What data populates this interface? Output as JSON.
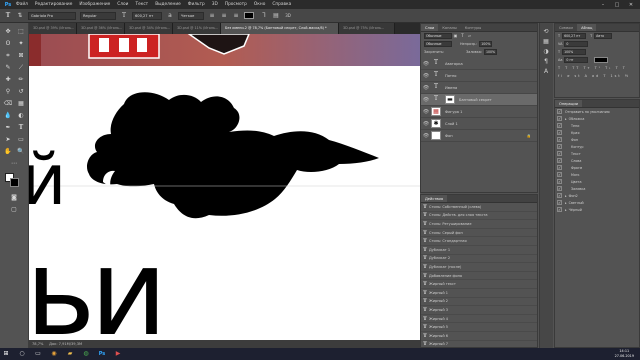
{
  "menu": [
    "Файл",
    "Редактирование",
    "Изображение",
    "Слои",
    "Текст",
    "Выделение",
    "Фильтр",
    "3D",
    "Просмотр",
    "Окно",
    "Справка"
  ],
  "options": {
    "font_family": "Gabriola Pro",
    "font_style": "Regular",
    "font_size": "600,27 пт",
    "aa": "Четкое",
    "color": "#000000"
  },
  "tabs": [
    {
      "label": "3D.psd @ 39% (Иголь...",
      "active": false
    },
    {
      "label": "3D.psd @ 36% (Иголь...",
      "active": false
    },
    {
      "label": "3D.psd @ 34% (Иголь...",
      "active": false
    },
    {
      "label": "3D.psd @ 11% (Иголь...",
      "active": false
    },
    {
      "label": "Без имени-2 @ 78,7% (Бантовый секрет, Слой-маска/8) *",
      "active": true
    },
    {
      "label": "3D.psd @ 75% (Иголь...",
      "active": false
    }
  ],
  "status": {
    "zoom": "78,7%",
    "doc": "Док: 7,91М/39,3М"
  },
  "layers_panel": {
    "tabs": [
      "Слои",
      "Каналы",
      "Контуры"
    ],
    "kind": "Обычные",
    "opacity_label": "Непрозр.:",
    "opacity": "100%",
    "fill_label": "Заливка:",
    "fill": "100%",
    "layers": [
      {
        "name": "Аватарка",
        "type": "T"
      },
      {
        "name": "Пятно",
        "type": "T"
      },
      {
        "name": "Имена",
        "type": "T"
      },
      {
        "name": "Бантовый секрет",
        "type": "T",
        "selected": true
      },
      {
        "name": "Фигура 1",
        "type": "img"
      },
      {
        "name": "Слой 1",
        "type": "img"
      },
      {
        "name": "Фон",
        "type": "bg"
      }
    ]
  },
  "history_panel": {
    "title": "Действия",
    "items": [
      "Стиль: Собственный (слева)",
      "Стиль: Действ. для слоя текста",
      "Стиль: Ретуширование",
      "Стиль: Серый фон",
      "Стиль: Стандартная",
      "Дубликат 1",
      "Дубликат 2",
      "Дубликат (после)",
      "Добавление фона",
      "Жирный текст",
      "Жирный 1",
      "Жирный 2",
      "Жирный 3",
      "Жирный 4",
      "Жирный 5",
      "Жирный 6",
      "Жирный 7",
      "Жирный 8"
    ]
  },
  "properties_panel": {
    "tabs": [
      "Символ",
      "Абзац"
    ],
    "fields": [
      {
        "label": "Т",
        "value": "600,27 пт"
      },
      {
        "label": "Т",
        "value": "Авто"
      },
      {
        "label": "VA",
        "value": "0"
      },
      {
        "label": "Т",
        "value": "100%"
      },
      {
        "label": "Аа",
        "value": "0 пт"
      }
    ]
  },
  "layer_comps": {
    "title": "Операции",
    "items": [
      "Отправить по умолчанию",
      "Обложка",
      "Тени",
      "Края",
      "Фон",
      "Контур",
      "Текст",
      "Слова",
      "Фрагм",
      "Мягк",
      "Цвета",
      "Заливка",
      "Фон2",
      "Светлый",
      "Чёрный"
    ]
  },
  "clock": {
    "time": "14:11",
    "date": "27.06.2019"
  }
}
